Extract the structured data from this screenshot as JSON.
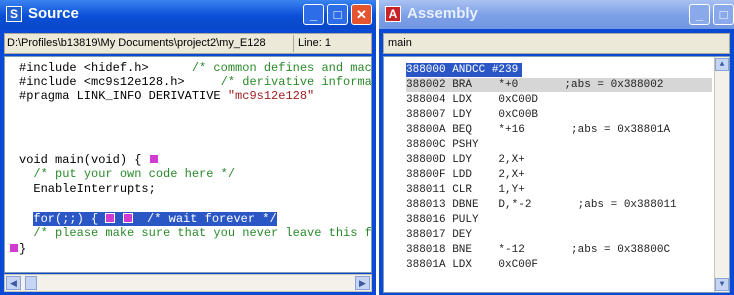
{
  "source": {
    "title": "Source",
    "icon_letter": "S",
    "path": "D:\\Profiles\\b13819\\My Documents\\project2\\my_E128",
    "line_indicator": "Line: 1",
    "code": [
      {
        "text": "#include <hidef.h>      ",
        "comment": "/* common defines and macr"
      },
      {
        "text": "#include <mc9s12e128.h>     ",
        "comment": "/* derivative informat"
      },
      {
        "text": "#pragma LINK_INFO DERIVATIVE ",
        "string": "\"mc9s12e128\""
      },
      {
        "text": "void main(void) {"
      },
      {
        "comment": "/* put your own code here */"
      },
      {
        "text": "EnableInterrupts;"
      },
      {
        "keyword": "for",
        "text": "(;;) {",
        "comment": " /* wait forever */"
      },
      {
        "comment": "/* please make sure that you never leave this fu"
      },
      {
        "text": "}"
      }
    ]
  },
  "assembly": {
    "title": "Assembly",
    "icon_letter": "A",
    "function": "main",
    "lines": [
      "388000 ANDCC #239",
      "388002 BRA    *+0       ;abs = 0x388002",
      "388004 LDX    0xC00D",
      "388007 LDY    0xC00B",
      "38800A BEQ    *+16       ;abs = 0x38801A",
      "38800C PSHY",
      "38800D LDY    2,X+",
      "38800F LDD    2,X+",
      "388011 CLR    1,Y+",
      "388013 DBNE   D,*-2       ;abs = 0x388011",
      "388016 PULY",
      "388017 DEY",
      "388018 BNE    *-12       ;abs = 0x38800C",
      "38801A LDX    0xC00F"
    ]
  }
}
